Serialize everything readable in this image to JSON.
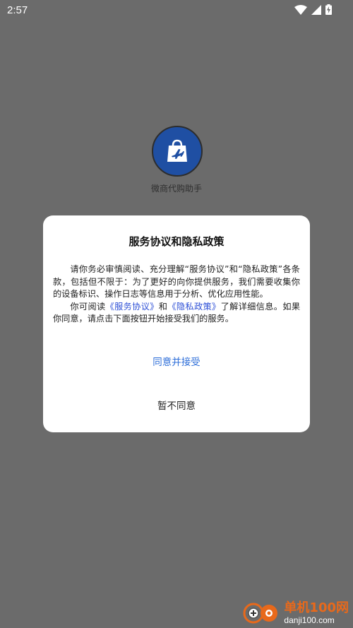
{
  "status_bar": {
    "time": "2:57",
    "icons": [
      "wifi-icon",
      "signal-icon",
      "battery-charging-icon"
    ]
  },
  "app": {
    "name": "微商代购助手",
    "logo_icon": "shopping-bag-plane-icon",
    "logo_color": "#1f4fa3"
  },
  "dialog": {
    "title": "服务协议和隐私政策",
    "paragraph1": "请你务必审慎阅读、充分理解“服务协议”和“隐私政策”各条款，包括但不限于：为了更好的向你提供服务，我们需要收集你的设备标识、操作日志等信息用于分析、优化应用性能。",
    "p2_prefix": "你可阅读",
    "p2_link1": "《服务协议》",
    "p2_and": "和",
    "p2_link2": "《隐私政策》",
    "p2_suffix": "了解详细信息。如果你同意，请点击下面按钮开始接受我们的服务。",
    "agree_label": "同意并接受",
    "disagree_label": "暂不同意",
    "link_color": "#2d4fd6",
    "agree_color": "#2f6fd9"
  },
  "watermark": {
    "brand": "单机100网",
    "url": "danji100.com"
  }
}
